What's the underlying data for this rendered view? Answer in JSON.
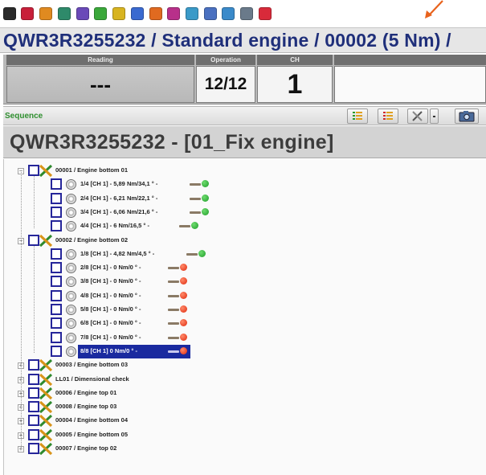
{
  "toolbar": {
    "icons": [
      {
        "name": "play-icon",
        "color": "#2a2a2a"
      },
      {
        "name": "stop-icon",
        "color": "#c8203a"
      },
      {
        "name": "tools-icon",
        "color": "#e08a20"
      },
      {
        "name": "chart-icon",
        "color": "#2e8a6a"
      },
      {
        "name": "connect-icon",
        "color": "#6a4ab8"
      },
      {
        "name": "puzzle-icon",
        "color": "#3aa83a"
      },
      {
        "name": "wrench-icon",
        "color": "#d8b420"
      },
      {
        "name": "download-icon",
        "color": "#3a6ad0"
      },
      {
        "name": "thermometer-icon",
        "color": "#e06a20"
      },
      {
        "name": "group-icon",
        "color": "#b8308a"
      },
      {
        "name": "graph-icon",
        "color": "#3a9ac8"
      },
      {
        "name": "brush-icon",
        "color": "#4a70c0"
      },
      {
        "name": "refresh-icon",
        "color": "#3a8aca"
      },
      {
        "name": "speaker-icon",
        "color": "#6a7a8a"
      },
      {
        "name": "power-icon",
        "color": "#d82a3a"
      }
    ],
    "arrow_color": "#e8621c"
  },
  "header": {
    "title": "QWR3R3255232 / Standard engine / 00002 (5 Nm) /"
  },
  "counters": {
    "reading_label": "Reading",
    "reading_value": "---",
    "operation_label": "Operation",
    "operation_value": "12/12",
    "ch_label": "CH",
    "ch_value": "1"
  },
  "sequence": {
    "label": "Sequence",
    "buttons": [
      "list-green-icon",
      "list-red-icon",
      "tools-icon",
      "dropdown-icon",
      "camera-icon"
    ]
  },
  "program": {
    "title": "QWR3R3255232 - [01_Fix engine]"
  },
  "tree": {
    "groups": [
      {
        "label": "00001 / Engine bottom 01",
        "expanded": true,
        "ops": [
          {
            "label": "1/4 [CH 1] - 5,89 Nm/34,1 ° -",
            "status": "ok"
          },
          {
            "label": "2/4 [CH 1] - 6,21 Nm/22,1 ° -",
            "status": "ok"
          },
          {
            "label": "3/4 [CH 1] - 6,06 Nm/21,6 ° -",
            "status": "ok"
          },
          {
            "label": "4/4 [CH 1] - 6 Nm/16,5 ° -",
            "status": "ok"
          }
        ]
      },
      {
        "label": "00002 / Engine bottom 02",
        "expanded": true,
        "ops": [
          {
            "label": "1/8 [CH 1] - 4,82 Nm/4,5 ° -",
            "status": "ok"
          },
          {
            "label": "2/8 [CH 1] - 0 Nm/0 ° -",
            "status": "nok"
          },
          {
            "label": "3/8 [CH 1] - 0 Nm/0 ° -",
            "status": "nok"
          },
          {
            "label": "4/8 [CH 1] - 0 Nm/0 ° -",
            "status": "nok"
          },
          {
            "label": "5/8 [CH 1] - 0 Nm/0 ° -",
            "status": "nok"
          },
          {
            "label": "6/8 [CH 1] - 0 Nm/0 ° -",
            "status": "nok"
          },
          {
            "label": "7/8 [CH 1] - 0 Nm/0 ° -",
            "status": "nok"
          },
          {
            "label": "8/8 [CH 1]   0 Nm/0 ° -",
            "status": "nok",
            "selected": true
          }
        ]
      },
      {
        "label": "00003 / Engine bottom 03",
        "expanded": false,
        "ops": []
      },
      {
        "label": "LL01 / Dimensional check",
        "expanded": false,
        "ops": []
      },
      {
        "label": "00006 / Engine top 01",
        "expanded": false,
        "ops": []
      },
      {
        "label": "00008 / Engine top 03",
        "expanded": false,
        "ops": []
      },
      {
        "label": "00004 / Engine bottom 04",
        "expanded": false,
        "ops": []
      },
      {
        "label": "00005 / Engine bottom 05",
        "expanded": false,
        "ops": []
      },
      {
        "label": "00007 / Engine top 02",
        "expanded": false,
        "ops": []
      }
    ]
  },
  "colors": {
    "title": "#1f2f7a",
    "status_ok": "#1f9d2a",
    "status_nok": "#e02a0e",
    "selection": "#1a2a9f",
    "sequence_label": "#2f8f2f"
  }
}
